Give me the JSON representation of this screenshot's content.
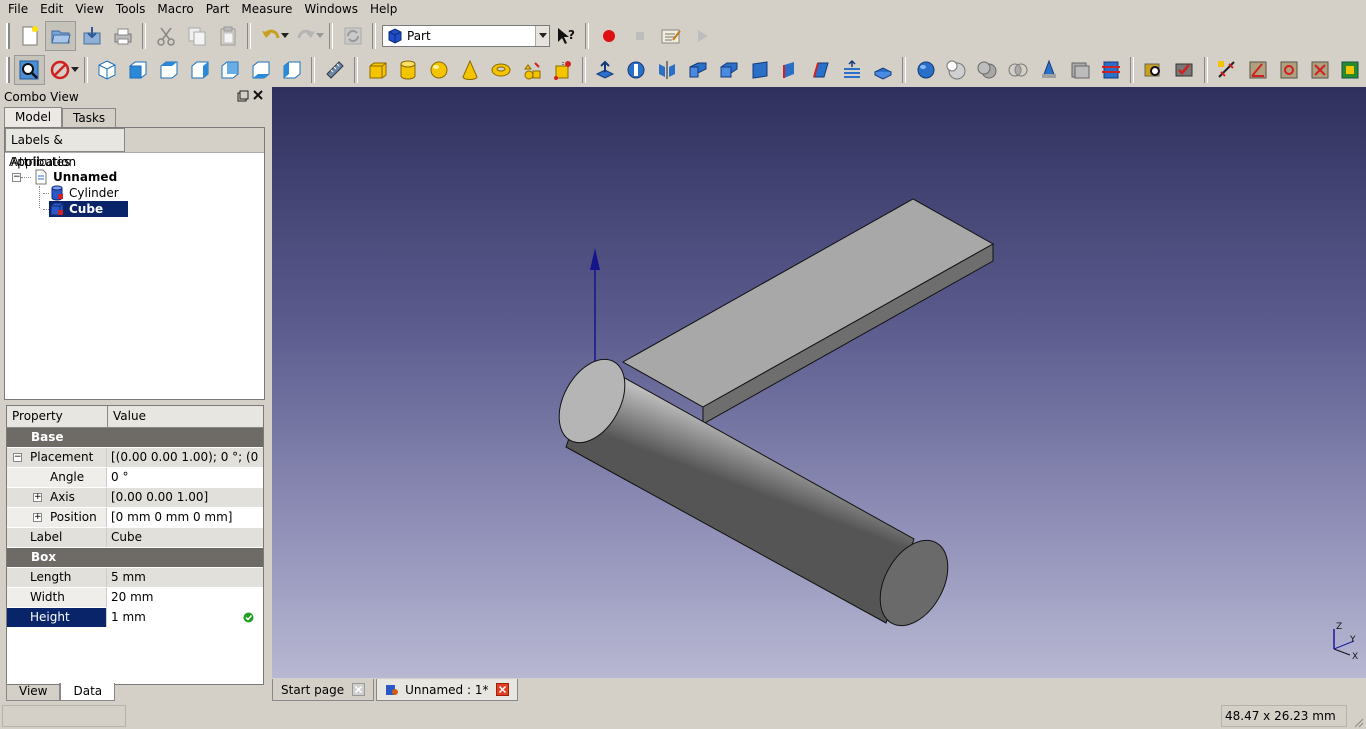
{
  "menubar": {
    "items": [
      {
        "label": "File"
      },
      {
        "label": "Edit"
      },
      {
        "label": "View"
      },
      {
        "label": "Tools"
      },
      {
        "label": "Macro"
      },
      {
        "label": "Part"
      },
      {
        "label": "Measure"
      },
      {
        "label": "Windows"
      },
      {
        "label": "Help"
      }
    ]
  },
  "workbench": {
    "selected": "Part"
  },
  "combo_view": {
    "title": "Combo View",
    "tabs": [
      "Model",
      "Tasks"
    ],
    "tree": {
      "header": "Labels & Attributes",
      "root": "Application",
      "document": "Unnamed",
      "objects": [
        "Cylinder",
        "Cube"
      ]
    },
    "properties": {
      "headers": [
        "Property",
        "Value"
      ],
      "groups": {
        "base": "Base",
        "box": "Box"
      },
      "rows": {
        "placement": {
          "name": "Placement",
          "value": "[(0.00 0.00 1.00); 0 °; (0 ..."
        },
        "angle": {
          "name": "Angle",
          "value": "0 °"
        },
        "axis": {
          "name": "Axis",
          "value": "[0.00 0.00 1.00]"
        },
        "position": {
          "name": "Position",
          "value": "[0 mm  0 mm  0 mm]"
        },
        "label": {
          "name": "Label",
          "value": "Cube"
        },
        "length": {
          "name": "Length",
          "value": "5 mm"
        },
        "width": {
          "name": "Width",
          "value": "20 mm"
        },
        "height": {
          "name": "Height",
          "value": "1 mm"
        }
      }
    },
    "bottom_tabs": [
      "View",
      "Data"
    ]
  },
  "axis_labels": {
    "z": "Z",
    "y": "Y",
    "x": "X"
  },
  "doc_tabs": [
    {
      "label": "Start page"
    },
    {
      "label": "Unnamed : 1*"
    }
  ],
  "status": {
    "dimensions": "48.47 x 26.23 mm"
  },
  "colors": {
    "selection": "#0a246a",
    "group_header": "#6e6b66",
    "viewport_top": "#30305e",
    "viewport_bottom": "#b8b8d3"
  }
}
